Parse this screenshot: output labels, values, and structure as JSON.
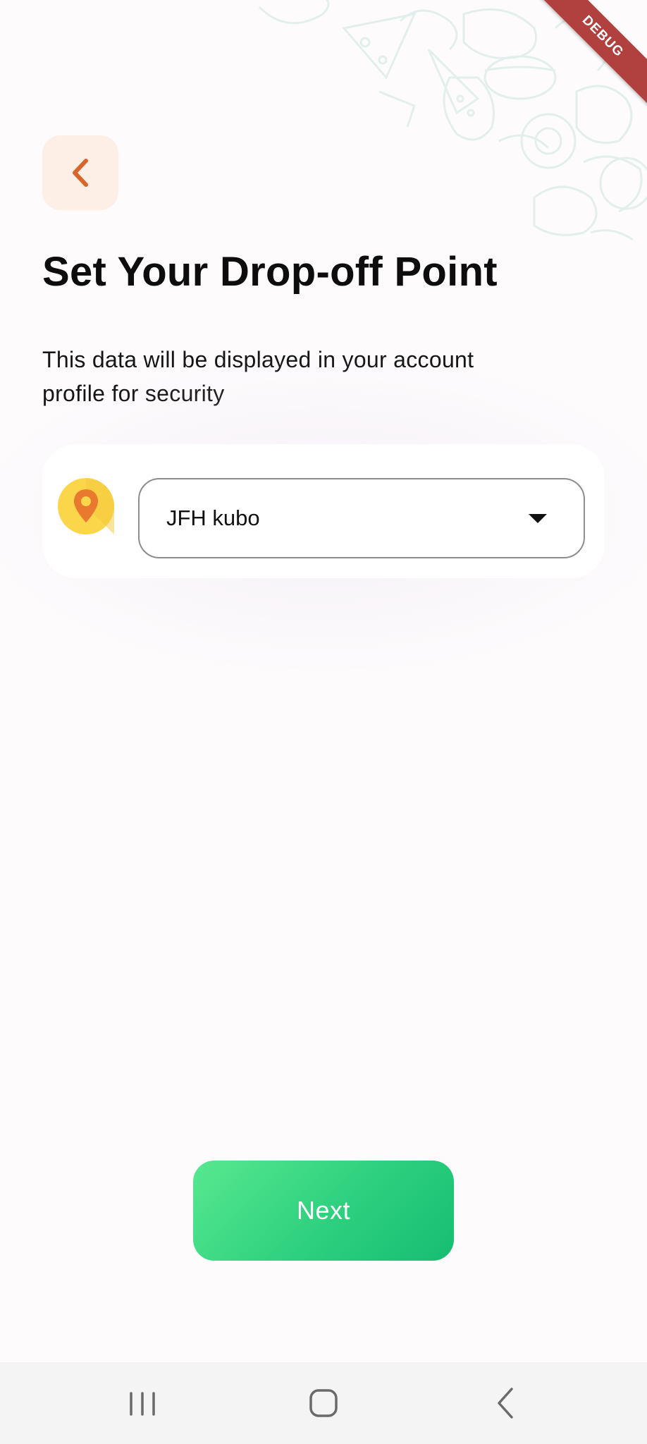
{
  "debug_banner": {
    "label": "DEBUG"
  },
  "header": {
    "back_icon": "chevron-left-icon",
    "title": "Set Your Drop-off Point",
    "subtitle": "This data will be displayed in your account profile for security"
  },
  "dropoff": {
    "icon": "location-pin-icon",
    "selected_value": "JFH kubo"
  },
  "actions": {
    "next_label": "Next"
  },
  "system_nav": {
    "items": [
      "recent-apps-icon",
      "home-icon",
      "back-icon"
    ]
  },
  "colors": {
    "accent_orange": "#d8652a",
    "back_bg": "#fdeee6",
    "button_gradient_start": "#58e890",
    "button_gradient_end": "#16bd72",
    "pin_yellow": "#fbd54a",
    "debug_red": "#b0413e"
  }
}
